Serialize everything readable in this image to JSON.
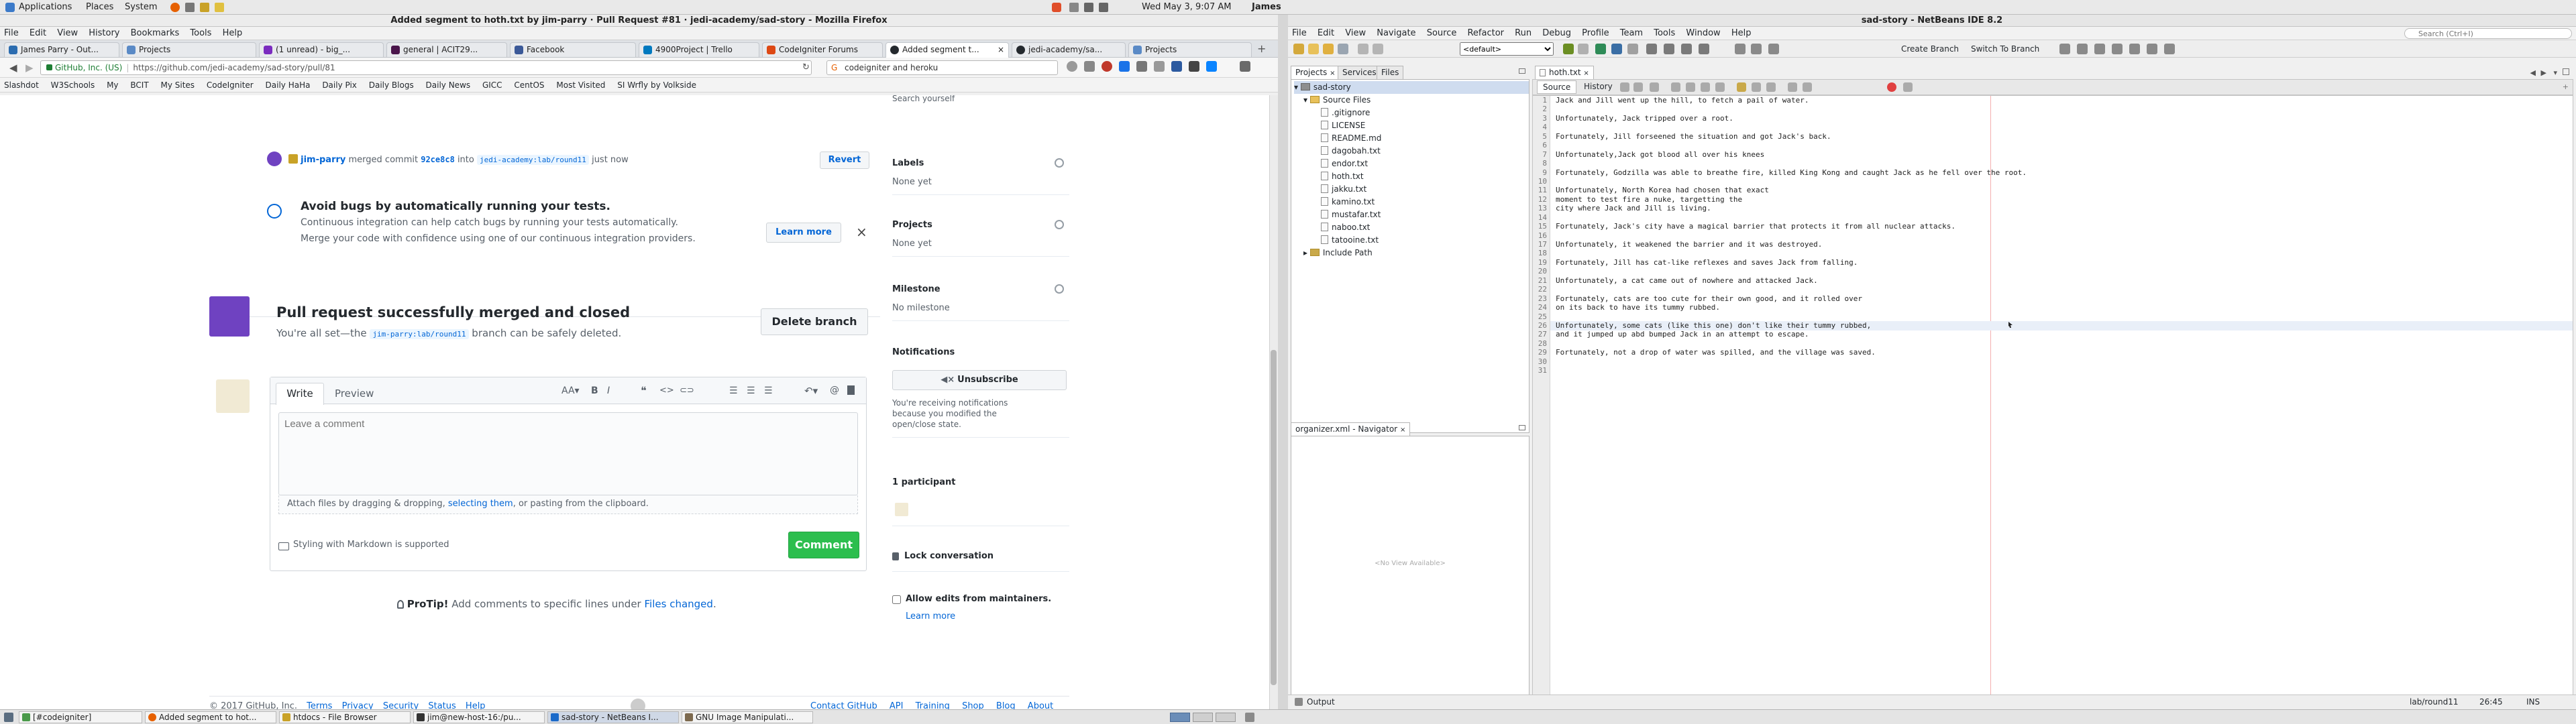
{
  "system_bar": {
    "menus": [
      "Applications",
      "Places",
      "System"
    ],
    "clock": "Wed May 3, 9:07 AM",
    "user": "James"
  },
  "firefox": {
    "window_title": "Added segment to hoth.txt by jim-parry · Pull Request #81 · jedi-academy/sad-story - Mozilla Firefox",
    "menu": [
      "File",
      "Edit",
      "View",
      "History",
      "Bookmarks",
      "Tools",
      "Help"
    ],
    "tabs": [
      {
        "label": "James Parry - Out...",
        "color": "#2b6cb0"
      },
      {
        "label": "Projects",
        "color": "#5a8ac6"
      },
      {
        "label": "(1 unread) - big_...",
        "color": "#7b2cbf"
      },
      {
        "label": "general | ACIT29...",
        "color": "#4a154b"
      },
      {
        "label": "Facebook",
        "color": "#3b5998"
      },
      {
        "label": "4900Project | Trello",
        "color": "#0079bf"
      },
      {
        "label": "CodeIgniter Forums",
        "color": "#dd4814"
      },
      {
        "label": "Added segment t...",
        "color": "#24292e",
        "active": true
      },
      {
        "label": "jedi-academy/sa...",
        "color": "#24292e"
      },
      {
        "label": "Projects",
        "color": "#5a8ac6"
      }
    ],
    "url_identity": "GitHub, Inc. (US)",
    "url": "https://github.com/jedi-academy/sad-story/pull/81",
    "search_value": "codeigniter and heroku",
    "bookmarks": [
      "Slashdot",
      "W3Schools",
      "My",
      "BCIT",
      "My Sites",
      "CodeIgniter",
      "Daily HaHa",
      "Daily Pix",
      "Daily Blogs",
      "Daily News",
      "GICC",
      "CentOS",
      "Most Visited",
      "SI Wrfly by Volkside"
    ]
  },
  "github": {
    "cutoff_text": "Search yourself",
    "merge_event": {
      "user": "jim-parry",
      "verb": "merged commit",
      "commit": "92ce8c8",
      "into": "into",
      "branch": "jedi-academy:lab/round11",
      "time": "just now",
      "revert": "Revert"
    },
    "ci_tip": {
      "title": "Avoid bugs by automatically running your tests.",
      "line1": "Continuous integration can help catch bugs by running your tests automatically.",
      "line2": "Merge your code with confidence using one of our continuous integration providers.",
      "button": "Learn more"
    },
    "merged_box": {
      "title": "Pull request successfully merged and closed",
      "prefix": "You're all set—the",
      "branch": "jim-parry:lab/round11",
      "suffix": "branch can be safely deleted.",
      "delete_button": "Delete branch"
    },
    "comment": {
      "tab_write": "Write",
      "tab_preview": "Preview",
      "placeholder": "Leave a comment",
      "attach_prefix": "Attach files by dragging & dropping,",
      "attach_link": "selecting them",
      "attach_suffix": ", or pasting from the clipboard.",
      "markdown": "Styling with Markdown is supported",
      "button": "Comment"
    },
    "protip": {
      "label": "ProTip!",
      "text": "Add comments to specific lines under",
      "link": "Files changed",
      "end": "."
    },
    "sidebar": {
      "labels": {
        "title": "Labels",
        "value": "None yet"
      },
      "projects": {
        "title": "Projects",
        "value": "None yet"
      },
      "milestone": {
        "title": "Milestone",
        "value": "No milestone"
      },
      "notifications": {
        "title": "Notifications",
        "button": "Unsubscribe",
        "note1": "You're receiving notifications",
        "note2": "because you modified the",
        "note3": "open/close state."
      },
      "participants": "1 participant",
      "lock": "Lock conversation",
      "allow_edits": "Allow edits from maintainers.",
      "learn_more": "Learn more"
    },
    "footer": [
      "© 2017 GitHub, Inc.",
      "Terms",
      "Privacy",
      "Security",
      "Status",
      "Help",
      "Contact GitHub",
      "API",
      "Training",
      "Shop",
      "Blog",
      "About"
    ]
  },
  "taskbar": {
    "items": [
      {
        "label": "[#codeigniter]",
        "color": "#4a9a4a"
      },
      {
        "label": "Added segment to hot...",
        "color": "#e66000"
      },
      {
        "label": "htdocs - File Browser",
        "color": "#c9a227"
      },
      {
        "label": "jim@new-host-16:/pu...",
        "color": "#333333"
      },
      {
        "label": "sad-story - NetBeans I...",
        "color": "#1b6ac9",
        "active": true
      },
      {
        "label": "GNU Image Manipulati...",
        "color": "#7d6a4f"
      }
    ]
  },
  "netbeans": {
    "window_title": "sad-story - NetBeans IDE 8.2",
    "menu": [
      "File",
      "Edit",
      "View",
      "Navigate",
      "Source",
      "Refactor",
      "Run",
      "Debug",
      "Profile",
      "Team",
      "Tools",
      "Window",
      "Help"
    ],
    "search_placeholder": "Search (Ctrl+I)",
    "config": "<default>",
    "toolbar_text": [
      "Create Branch",
      "Switch To Branch"
    ],
    "panel_tabs": [
      "Projects",
      "Services",
      "Files"
    ],
    "project": "sad-story",
    "source_files": "Source Files",
    "files": [
      ".gitignore",
      "LICENSE",
      "README.md",
      "dagobah.txt",
      "endor.txt",
      "hoth.txt",
      "jakku.txt",
      "kamino.txt",
      "mustafar.txt",
      "naboo.txt",
      "tatooine.txt"
    ],
    "include_path": "Include Path",
    "navigator_tab": "organizer.xml - Navigator",
    "no_view": "<No View Available>",
    "editor_tab": "hoth.txt",
    "editor_subtabs": [
      "Source",
      "History"
    ],
    "lines": [
      "Jack and Jill went up the hill, to fetch a pail of water.",
      "",
      "Unfortunately, Jack tripped over a root.",
      "",
      "Fortunately, Jill forseened the situation and got Jack's back.",
      "",
      "Unfortunately,Jack got blood all over his knees",
      "",
      "Fortunately, Godzilla was able to breathe fire, killed King Kong and caught Jack as he fell over the root.",
      "",
      "Unfortunately, North Korea had chosen that exact",
      "moment to test fire a nuke, targetting the",
      "city where Jack and Jill is living.",
      "",
      "Fortunately, Jack's city have a magical barrier that protects it from all nuclear attacks.",
      "",
      "Unfortunately, it weakened the barrier and it was destroyed.",
      "",
      "Fortunately, Jill has cat-like reflexes and saves Jack from falling.",
      "",
      "Unfortunately, a cat came out of nowhere and attacked Jack.",
      "",
      "Fortunately, cats are too cute for their own good, and it rolled over",
      "on its back to have its tummy rubbed.",
      "",
      "Unfortunately, some cats (like this one) don't like their tummy rubbed,",
      "and it jumped up abd bumped Jack in an attempt to escape.",
      "",
      "Fortunately, not a drop of water was spilled, and the village was saved.",
      "",
      ""
    ],
    "output_tab": "Output",
    "status_branch": "lab/round11",
    "status_pos": "26:45",
    "status_mode": "INS"
  }
}
